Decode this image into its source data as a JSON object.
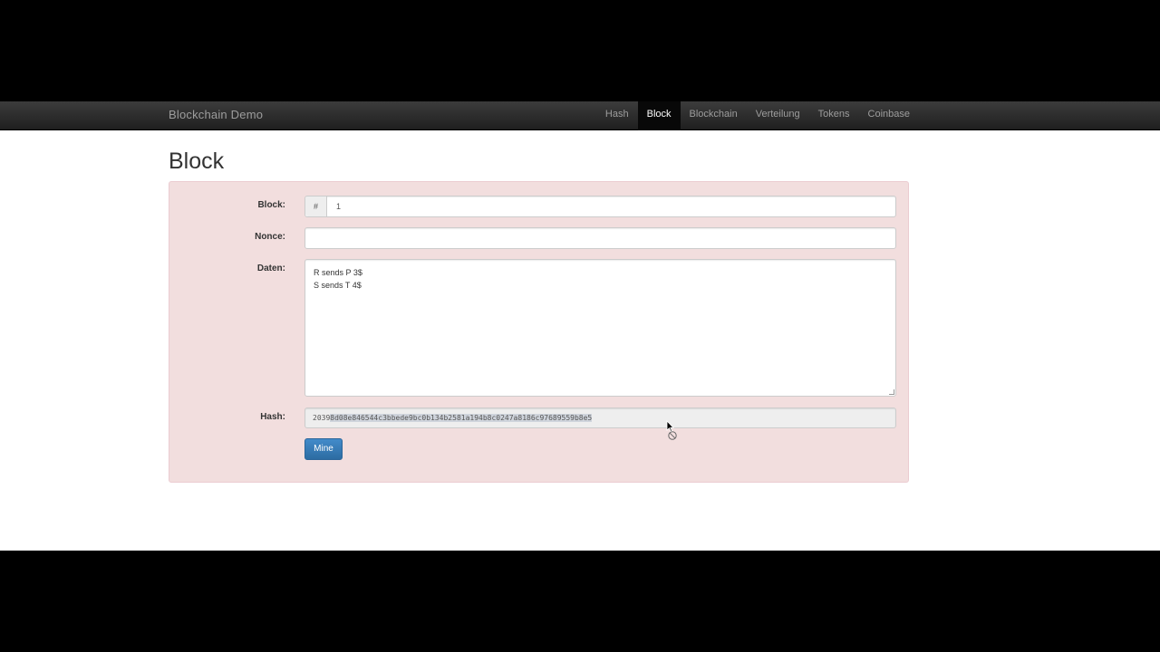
{
  "navbar": {
    "brand": "Blockchain Demo",
    "items": [
      {
        "label": "Hash",
        "active": false
      },
      {
        "label": "Block",
        "active": true
      },
      {
        "label": "Blockchain",
        "active": false
      },
      {
        "label": "Verteilung",
        "active": false
      },
      {
        "label": "Tokens",
        "active": false
      },
      {
        "label": "Coinbase",
        "active": false
      }
    ]
  },
  "page": {
    "title": "Block"
  },
  "form": {
    "block_label": "Block:",
    "block_addon": "#",
    "block_value": "1",
    "nonce_label": "Nonce:",
    "nonce_value": "",
    "data_label": "Daten:",
    "data_value": "R sends P 3$\nS sends T 4$",
    "hash_label": "Hash:",
    "hash_prefix": "2039",
    "hash_selected": "8d08e846544c3bbede9bc0b134b2581a194b8c0247a8186c97689559b8e5",
    "mine_label": "Mine"
  },
  "colors": {
    "well_bg": "#f2dede",
    "navbar_bg": "#222222",
    "button_primary": "#428bca"
  }
}
